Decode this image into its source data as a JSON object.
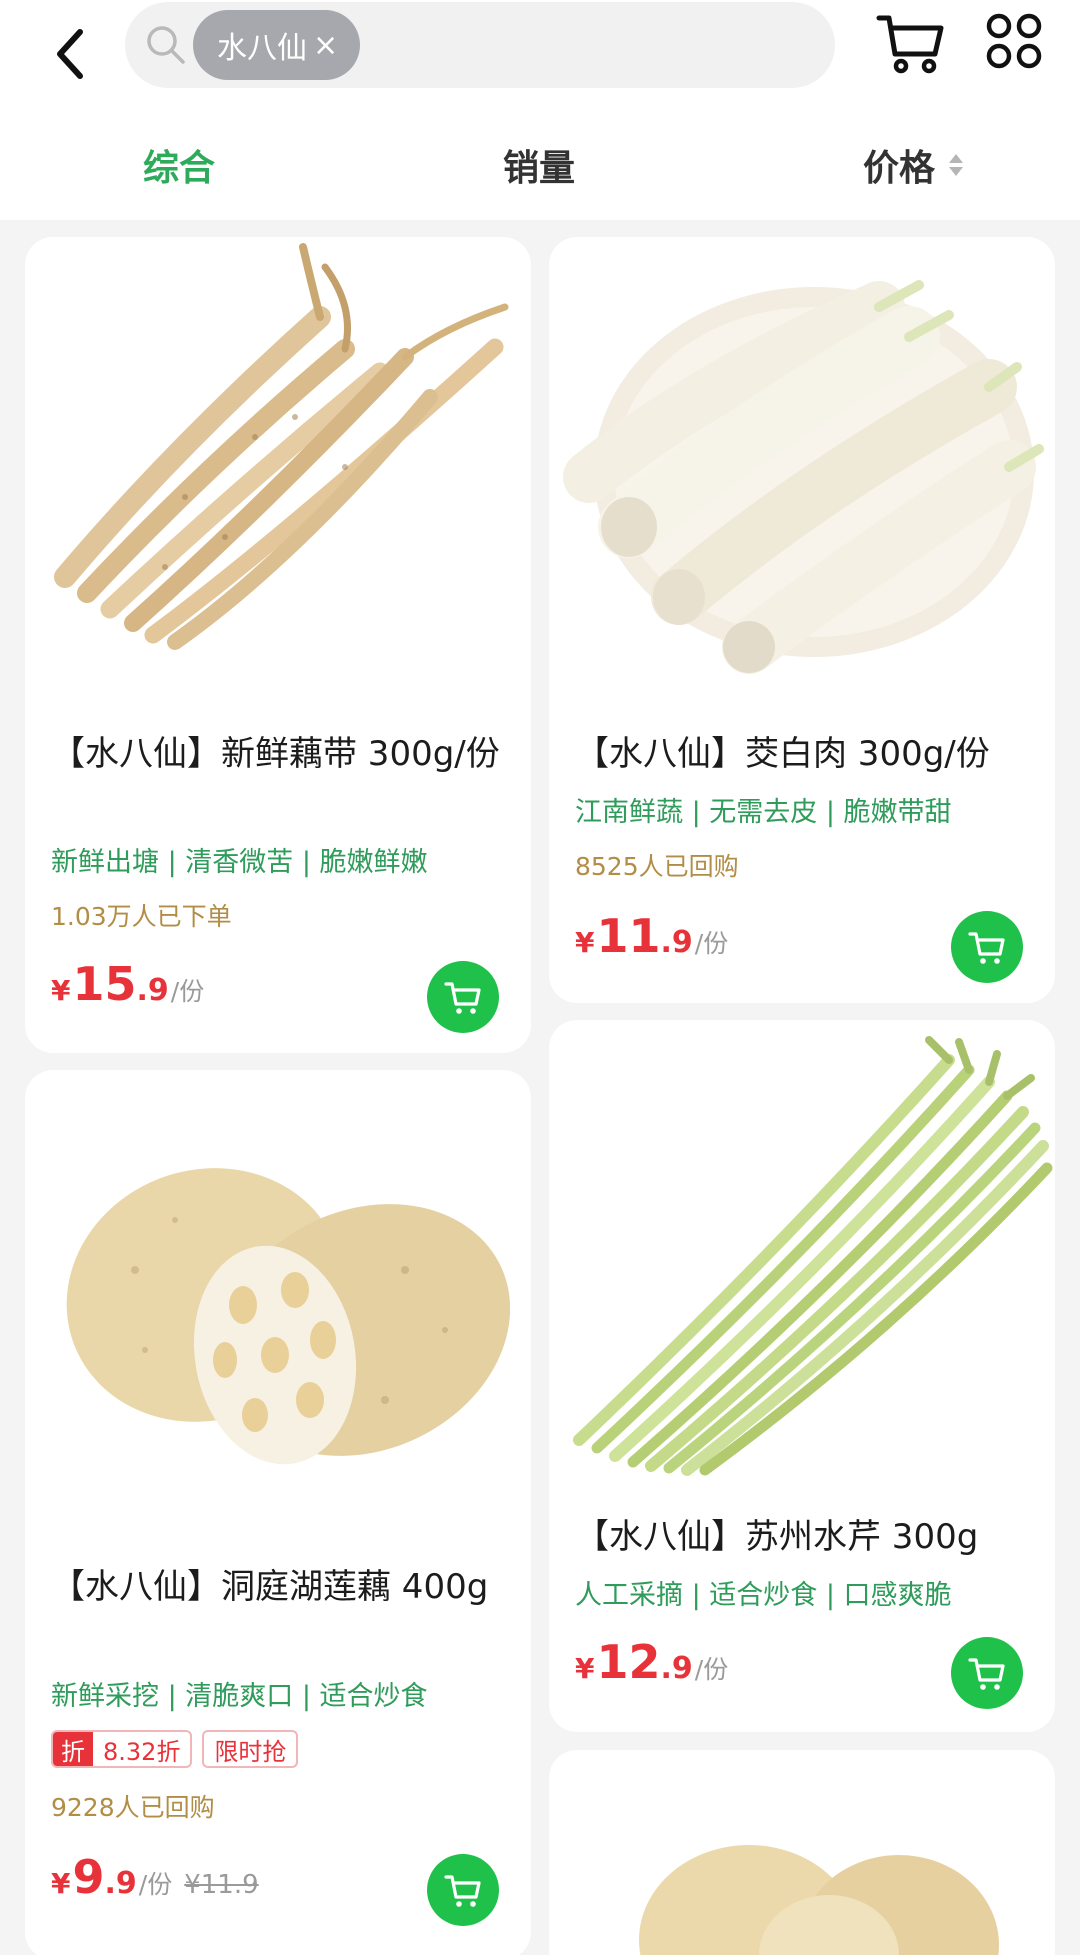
{
  "search": {
    "chip": "水八仙",
    "clear": "×"
  },
  "sort": [
    {
      "label": "综合"
    },
    {
      "label": "销量"
    },
    {
      "label": "价格"
    }
  ],
  "products": [
    {
      "title": "【水八仙】新鲜藕带 300g/份",
      "tags": "新鲜出塘 | 清香微苦 | 脆嫩鲜嫩",
      "buyers": "1.03万人已下单",
      "price": {
        "yen": "¥",
        "int": "15",
        "dec": ".9",
        "unit": "/份"
      }
    },
    {
      "title": "【水八仙】茭白肉 300g/份",
      "tags": "江南鲜蔬 | 无需去皮 | 脆嫩带甜",
      "buyers": "8525人已回购",
      "price": {
        "yen": "¥",
        "int": "11",
        "dec": ".9",
        "unit": "/份"
      }
    },
    {
      "title": "【水八仙】洞庭湖莲藕 400g",
      "tags": "新鲜采挖 | 清脆爽口 | 适合炒食",
      "discount": {
        "label": "折",
        "value": "8.32折",
        "tag": "限时抢"
      },
      "buyers": "9228人已回购",
      "price": {
        "yen": "¥",
        "int": "9",
        "dec": ".9",
        "unit": "/份",
        "original": "¥11.9"
      }
    },
    {
      "title": "【水八仙】苏州水芹 300g",
      "tags": "人工采摘 | 适合炒食 | 口感爽脆",
      "price": {
        "yen": "¥",
        "int": "12",
        "dec": ".9",
        "unit": "/份"
      }
    }
  ],
  "colors": {
    "accent": "#2daa5a",
    "price": "#e8323a",
    "cart_button": "#1fc14b",
    "buyers": "#b28d45"
  }
}
